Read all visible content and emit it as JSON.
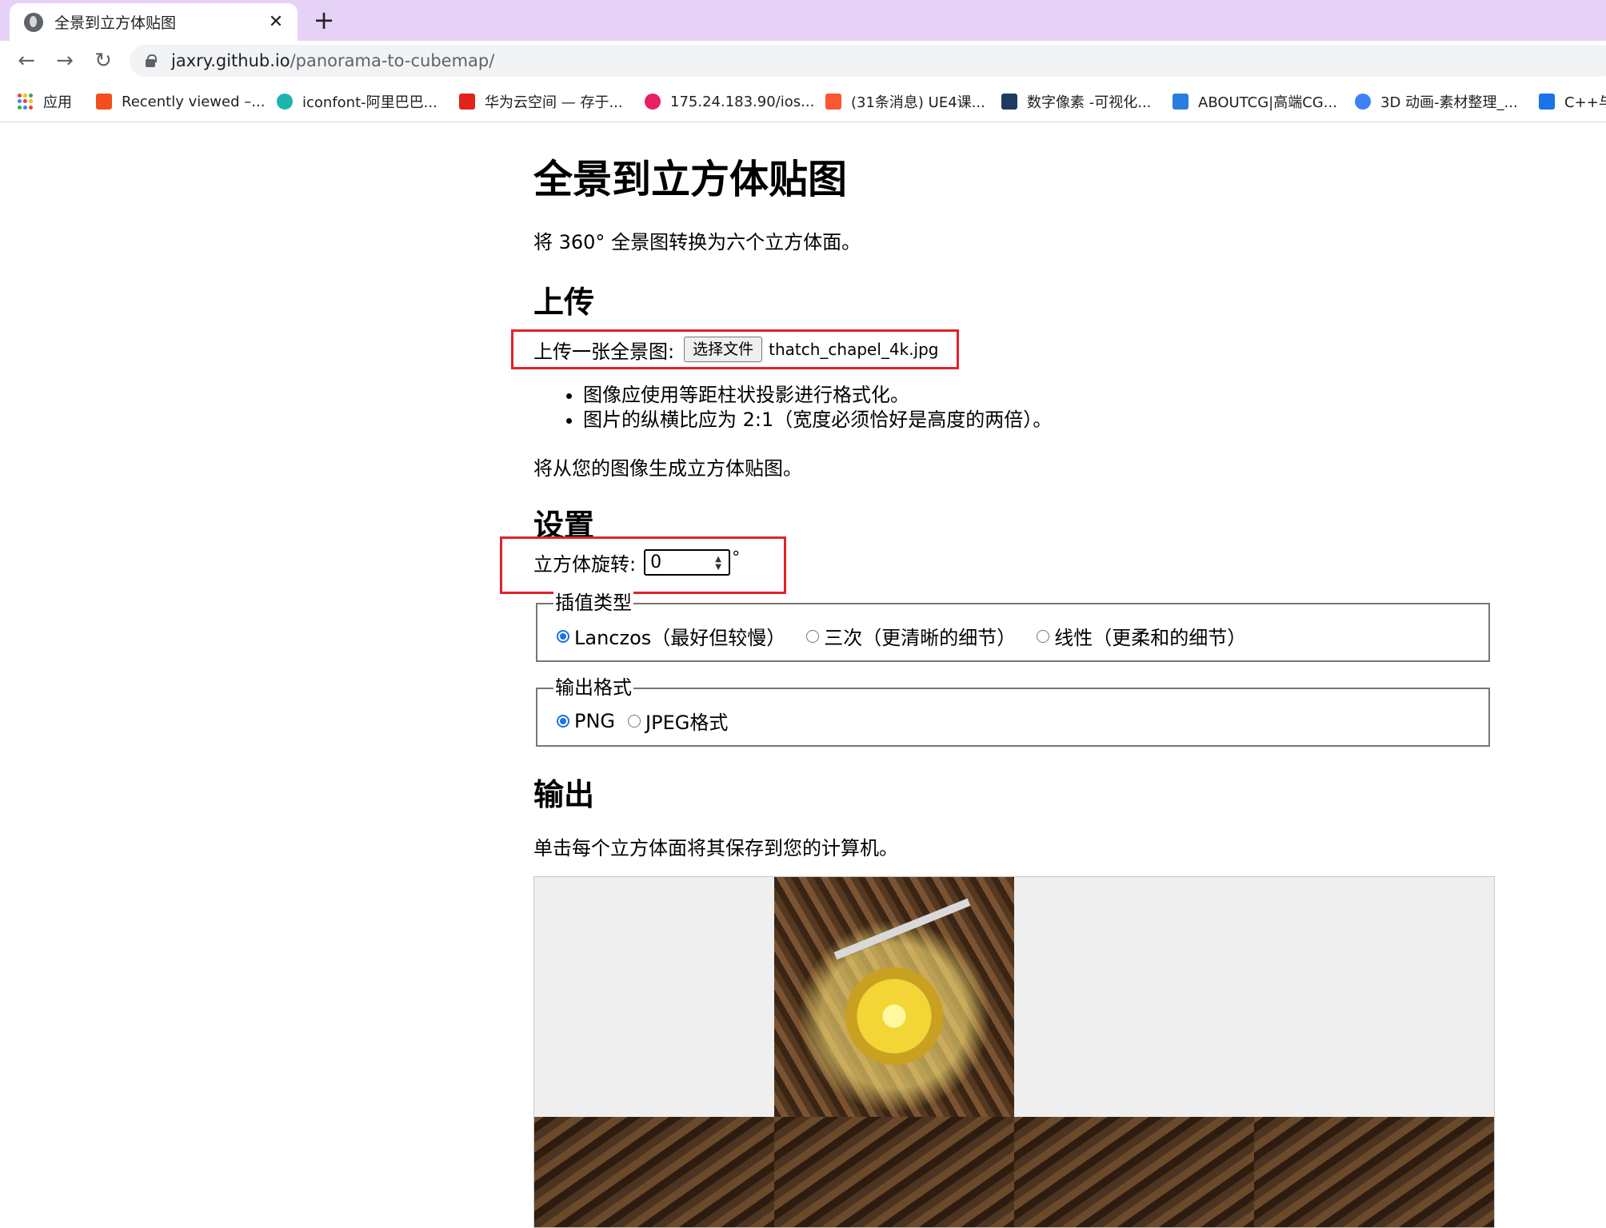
{
  "browser": {
    "tab_title": "全景到立方体贴图",
    "tab_close": "✕",
    "new_tab": "+",
    "nav": {
      "back": "←",
      "forward": "→",
      "reload": "↻"
    },
    "url_host": "jaxry.github.io",
    "url_path": "/panorama-to-cubemap/",
    "bookmarks": [
      {
        "label": "应用",
        "color": "#4285f4"
      },
      {
        "label": "Recently viewed –...",
        "color": "#f24e1e"
      },
      {
        "label": "iconfont-阿里巴巴...",
        "color": "#1cb5ac"
      },
      {
        "label": "华为云空间 — 存于...",
        "color": "#e2231a"
      },
      {
        "label": "175.24.183.90/ios...",
        "color": "#e91e63"
      },
      {
        "label": "(31条消息) UE4课...",
        "color": "#fc5531"
      },
      {
        "label": "数字像素 -可视化...",
        "color": "#1e3a5f"
      },
      {
        "label": "ABOUTCG|高端CG...",
        "color": "#2a7de1"
      },
      {
        "label": "3D 动画-素材整理_...",
        "color": "#3b82f6"
      },
      {
        "label": "C++与",
        "color": "#1a73e8"
      }
    ]
  },
  "page": {
    "title": "全景到立方体贴图",
    "intro": "将 360° 全景图转换为六个立方体面。",
    "upload": {
      "heading": "上传",
      "label": "上传一张全景图:",
      "button": "选择文件",
      "file_name": "thatch_chapel_4k.jpg",
      "notes": [
        "图像应使用等距柱状投影进行格式化。",
        "图片的纵横比应为 2:1（宽度必须恰好是高度的两倍）。"
      ],
      "after": "将从您的图像生成立方体贴图。"
    },
    "settings": {
      "heading": "设置",
      "rotation_label": "立方体旋转:",
      "rotation_value": "0",
      "rotation_unit": "°",
      "interpolation": {
        "legend": "插值类型",
        "options": [
          "Lanczos（最好但较慢）",
          "三次（更清晰的细节）",
          "线性（更柔和的细节）"
        ],
        "selected": 0
      },
      "format": {
        "legend": "输出格式",
        "options": [
          "PNG",
          "JPEG格式"
        ],
        "selected": 0
      }
    },
    "output": {
      "heading": "输出",
      "hint": "单击每个立方体面将其保存到您的计算机。"
    }
  },
  "colors": {
    "annotation_red": "#e0232a",
    "radio_accent": "#1a73e8",
    "tab_strip": "#e7d2f7"
  }
}
